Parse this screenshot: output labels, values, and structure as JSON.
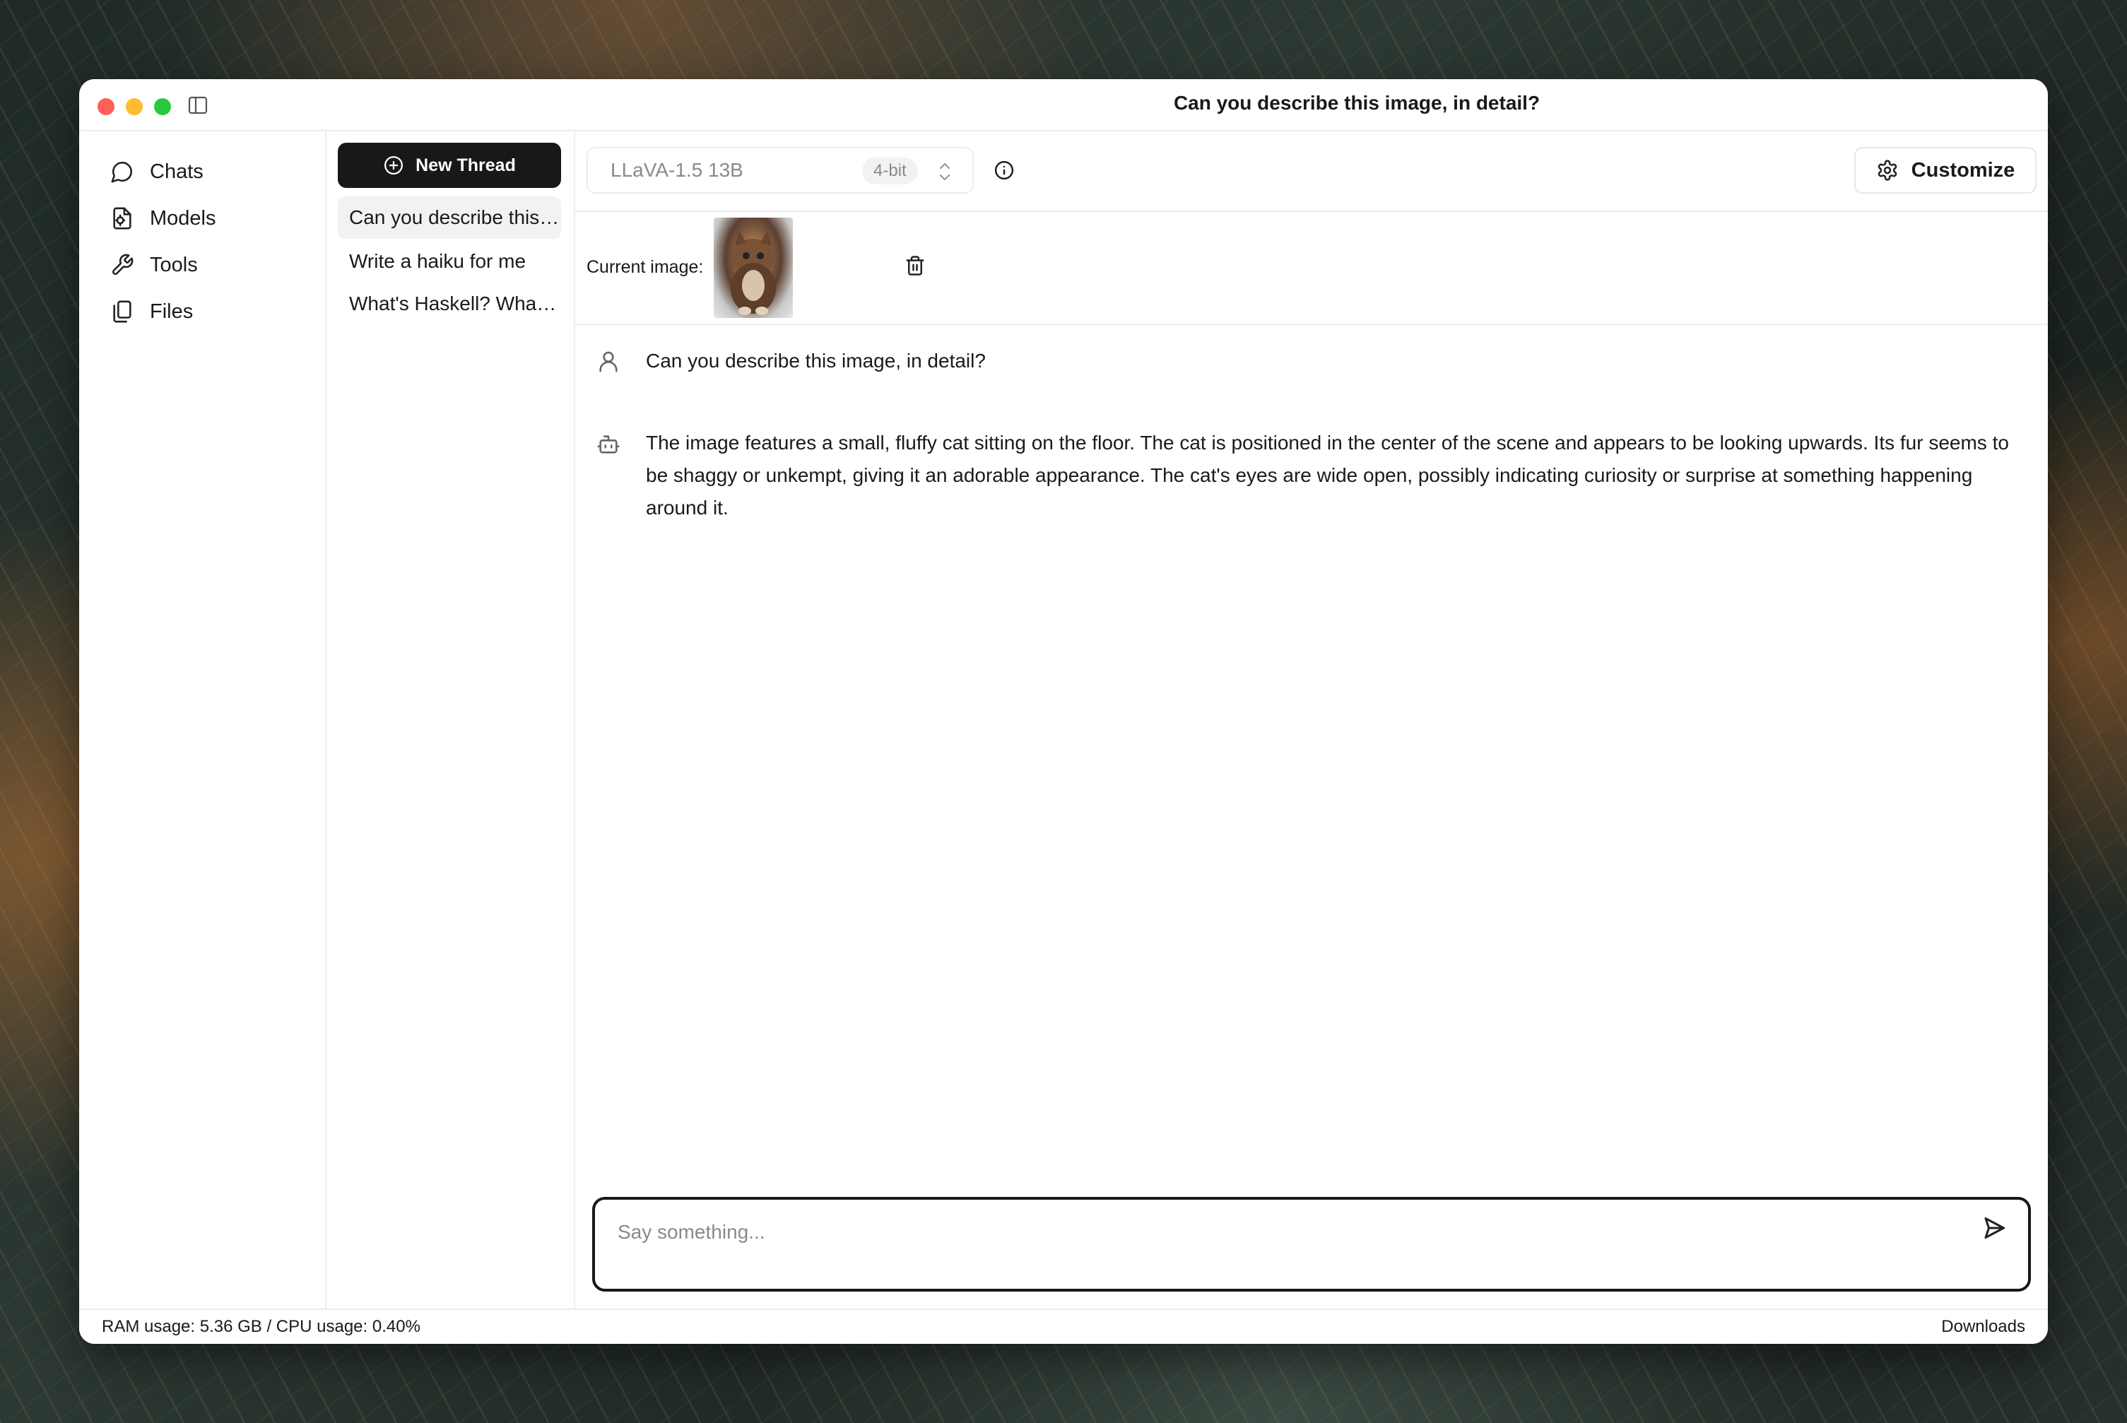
{
  "window": {
    "title": "Can you describe this image, in detail?"
  },
  "nav": {
    "items": [
      {
        "label": "Chats",
        "icon": "chat-bubble-icon"
      },
      {
        "label": "Models",
        "icon": "models-icon"
      },
      {
        "label": "Tools",
        "icon": "wrench-icon"
      },
      {
        "label": "Files",
        "icon": "files-icon"
      }
    ]
  },
  "threads": {
    "new_label": "New Thread",
    "items": [
      {
        "label": "Can you describe this image, in detail?"
      },
      {
        "label": "Write a haiku for me"
      },
      {
        "label": "What's Haskell? What is it used for?"
      }
    ]
  },
  "toolbar": {
    "model_name": "LLaVA-1.5 13B",
    "quantization": "4-bit",
    "customize_label": "Customize"
  },
  "image_bar": {
    "label": "Current image:"
  },
  "messages": [
    {
      "role": "user",
      "icon": "user-icon",
      "text": "Can you describe this image, in detail?"
    },
    {
      "role": "assistant",
      "icon": "bot-icon",
      "text": "The image features a small, fluffy cat sitting on the floor. The cat is positioned in the center of the scene and appears to be looking upwards. Its fur seems to be shaggy or unkempt, giving it an adorable appearance. The cat's eyes are wide open, possibly indicating curiosity or surprise at something happening around it."
    }
  ],
  "composer": {
    "placeholder": "Say something..."
  },
  "status": {
    "usage": "RAM usage: 5.36 GB / CPU usage: 0.40%",
    "downloads_label": "Downloads"
  }
}
